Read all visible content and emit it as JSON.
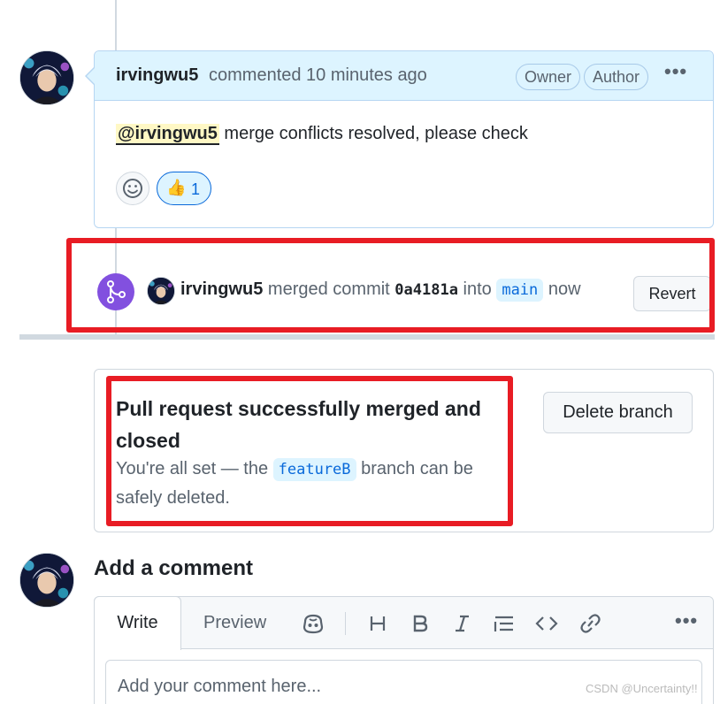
{
  "comment": {
    "author": "irvingwu5",
    "action": "commented 10 minutes ago",
    "labels": [
      "Owner",
      "Author"
    ],
    "more_icon": "kebab-horizontal-icon",
    "mention": "@irvingwu5",
    "body": "merge conflicts resolved, please check",
    "reaction": {
      "emoji": "👍",
      "count": "1"
    }
  },
  "merge_event": {
    "icon": "git-merge-icon",
    "user": "irvingwu5",
    "text_merged": "merged commit",
    "sha": "0a4181a",
    "text_into": "into",
    "branch": "main",
    "time": "now",
    "revert_label": "Revert"
  },
  "merged_status": {
    "title": "Pull request successfully merged and closed",
    "desc_prefix": "You're all set — the",
    "branch": "featureB",
    "desc_suffix": "branch can be safely deleted.",
    "delete_branch_label": "Delete branch"
  },
  "add_comment": {
    "heading": "Add a comment",
    "tab_write": "Write",
    "tab_preview": "Preview",
    "toolbar_icons": [
      "copilot-icon",
      "heading-icon",
      "bold-icon",
      "italic-icon",
      "list-icon",
      "code-icon",
      "link-icon",
      "kebab-horizontal-icon"
    ],
    "placeholder": "Add your comment here..."
  },
  "watermark": "CSDN @Uncertainty!!",
  "colors": {
    "accent_blue": "#0969da",
    "merged_purple": "#8250df",
    "highlight_red": "#e81c24",
    "header_blue": "#ddf4ff"
  }
}
